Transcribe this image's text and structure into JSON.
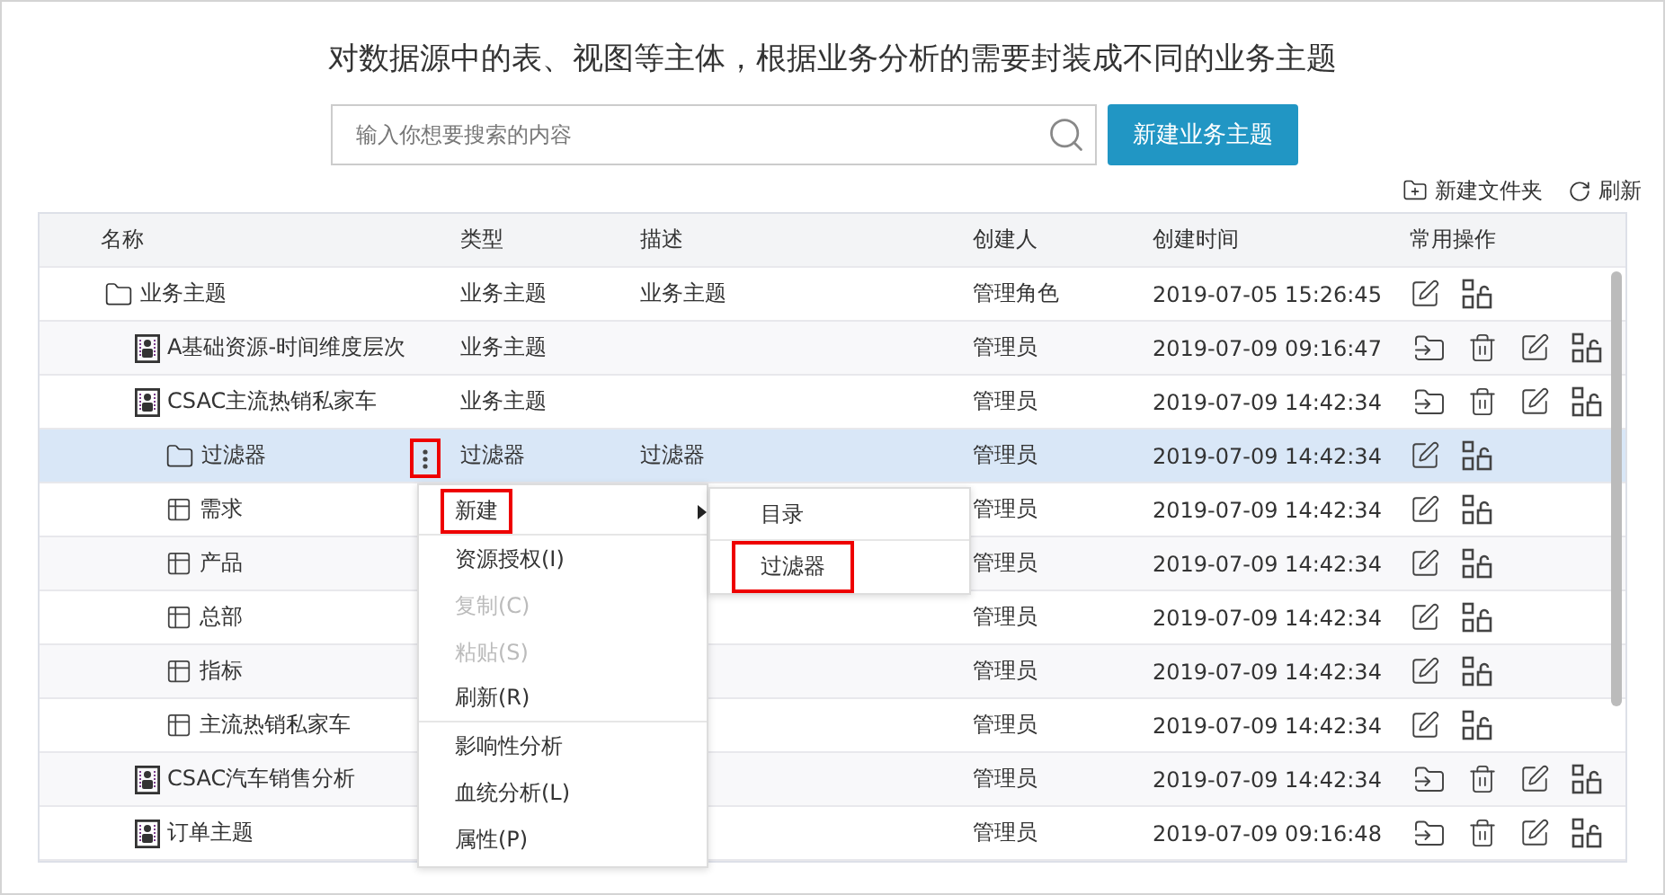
{
  "heading": "对数据源中的表、视图等主体，根据业务分析的需要封装成不同的业务主题",
  "search": {
    "placeholder": "输入你想要搜索的内容"
  },
  "primary_button": "新建业务主题",
  "toolbar": [
    {
      "kind": "new-folder",
      "label": "新建文件夹"
    },
    {
      "kind": "refresh",
      "label": "刷新"
    }
  ],
  "table": {
    "columns": [
      "名称",
      "类型",
      "描述",
      "创建人",
      "创建时间",
      "常用操作"
    ],
    "rows": [
      {
        "name": "业务主题",
        "kind": "folder",
        "type": "业务主题",
        "description": "业务主题",
        "creator": "管理角色",
        "created": "2019-07-05 15:26:45",
        "selected": false,
        "children": [
          {
            "name": "A基础资源-时间维度层次",
            "kind": "subject",
            "type": "业务主题",
            "creator": "管理员",
            "created": "2019-07-09 09:16:47",
            "selected": false
          },
          {
            "name": "CSAC主流热销私家车",
            "kind": "subject",
            "type": "业务主题",
            "creator": "管理员",
            "created": "2019-07-09 14:42:34",
            "selected": false,
            "children": [
              {
                "name": "过滤器",
                "kind": "folder",
                "type": "过滤器",
                "description": "过滤器",
                "creator": "管理员",
                "created": "2019-07-09 14:42:34",
                "selected": true,
                "more_button": {
                  "highlighted": true
                }
              },
              {
                "name": "需求",
                "kind": "table",
                "creator": "管理员",
                "created": "2019-07-09 14:42:34",
                "selected": false
              },
              {
                "name": "产品",
                "kind": "table",
                "creator": "管理员",
                "created": "2019-07-09 14:42:34",
                "selected": false
              },
              {
                "name": "总部",
                "kind": "table",
                "creator": "管理员",
                "created": "2019-07-09 14:42:34",
                "selected": false
              },
              {
                "name": "指标",
                "kind": "table",
                "creator": "管理员",
                "created": "2019-07-09 14:42:34",
                "selected": false
              },
              {
                "name": "主流热销私家车",
                "kind": "table",
                "creator": "管理员",
                "created": "2019-07-09 14:42:34",
                "selected": false
              }
            ]
          },
          {
            "name": "CSAC汽车销售分析",
            "kind": "subject",
            "creator": "管理员",
            "created": "2019-07-09 14:42:34",
            "selected": false
          },
          {
            "name": "订单主题",
            "kind": "subject",
            "creator": "管理员",
            "created": "2019-07-09 09:16:48",
            "selected": false
          }
        ]
      }
    ]
  },
  "context_menu": {
    "items": [
      {
        "label": "新建",
        "disabled": false,
        "highlighted": true,
        "has_submenu": true,
        "divider_after": true
      },
      {
        "label": "资源授权(I)",
        "disabled": false,
        "highlighted": false,
        "has_submenu": false,
        "divider_after": false
      },
      {
        "label": "复制(C)",
        "disabled": true,
        "highlighted": false,
        "has_submenu": false,
        "divider_after": false
      },
      {
        "label": "粘贴(S)",
        "disabled": true,
        "highlighted": false,
        "has_submenu": false,
        "divider_after": false
      },
      {
        "label": "刷新(R)",
        "disabled": false,
        "highlighted": false,
        "has_submenu": false,
        "divider_after": true
      },
      {
        "label": "影响性分析",
        "disabled": false,
        "highlighted": false,
        "has_submenu": false,
        "divider_after": false
      },
      {
        "label": "血统分析(L)",
        "disabled": false,
        "highlighted": false,
        "has_submenu": false,
        "divider_after": false
      },
      {
        "label": "属性(P)",
        "disabled": false,
        "highlighted": false,
        "has_submenu": false,
        "divider_after": false
      }
    ],
    "submenu": [
      {
        "label": "目录",
        "highlighted": false,
        "divider_after": true
      },
      {
        "label": "过滤器",
        "highlighted": true,
        "divider_after": false
      }
    ]
  }
}
